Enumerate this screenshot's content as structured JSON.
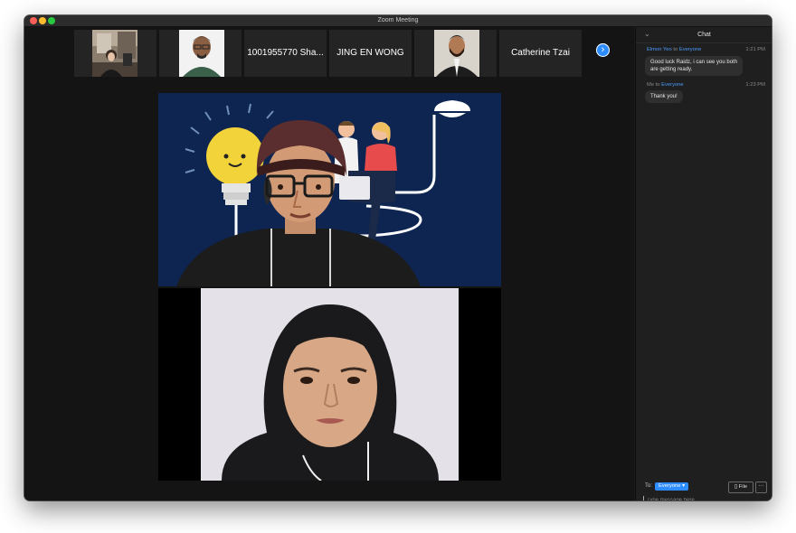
{
  "window": {
    "title": "Zoom Meeting"
  },
  "participants": [
    {
      "name": "",
      "has_video": true
    },
    {
      "name": "",
      "has_video": true
    },
    {
      "name": "1001955770 Sha...",
      "has_video": false
    },
    {
      "name": "JING EN WONG",
      "has_video": false
    },
    {
      "name": "",
      "has_video": true
    },
    {
      "name": "Catherine Tzai",
      "has_video": false
    }
  ],
  "strip_next_icon": "chevron-right-icon",
  "chat": {
    "title": "Chat",
    "collapse_icon": "chevron-down-icon",
    "messages": [
      {
        "from": "Elmon Yeo",
        "to_word": "to",
        "to": "Everyone",
        "time": "1:21 PM",
        "lines": [
          "Good luck Raidz, i can see you both",
          "are getting ready."
        ]
      },
      {
        "from": "Me",
        "to_word": "to",
        "to": "Everyone",
        "time": "1:23 PM",
        "lines": [
          "Thank you!"
        ]
      }
    ],
    "to_label": "To:",
    "to_value": "Everyone",
    "file_label": "File",
    "more_label": "···",
    "input_placeholder": "Type message here..."
  },
  "colors": {
    "accent": "#2d8cff",
    "link": "#4a9bff",
    "background": "#141414"
  }
}
